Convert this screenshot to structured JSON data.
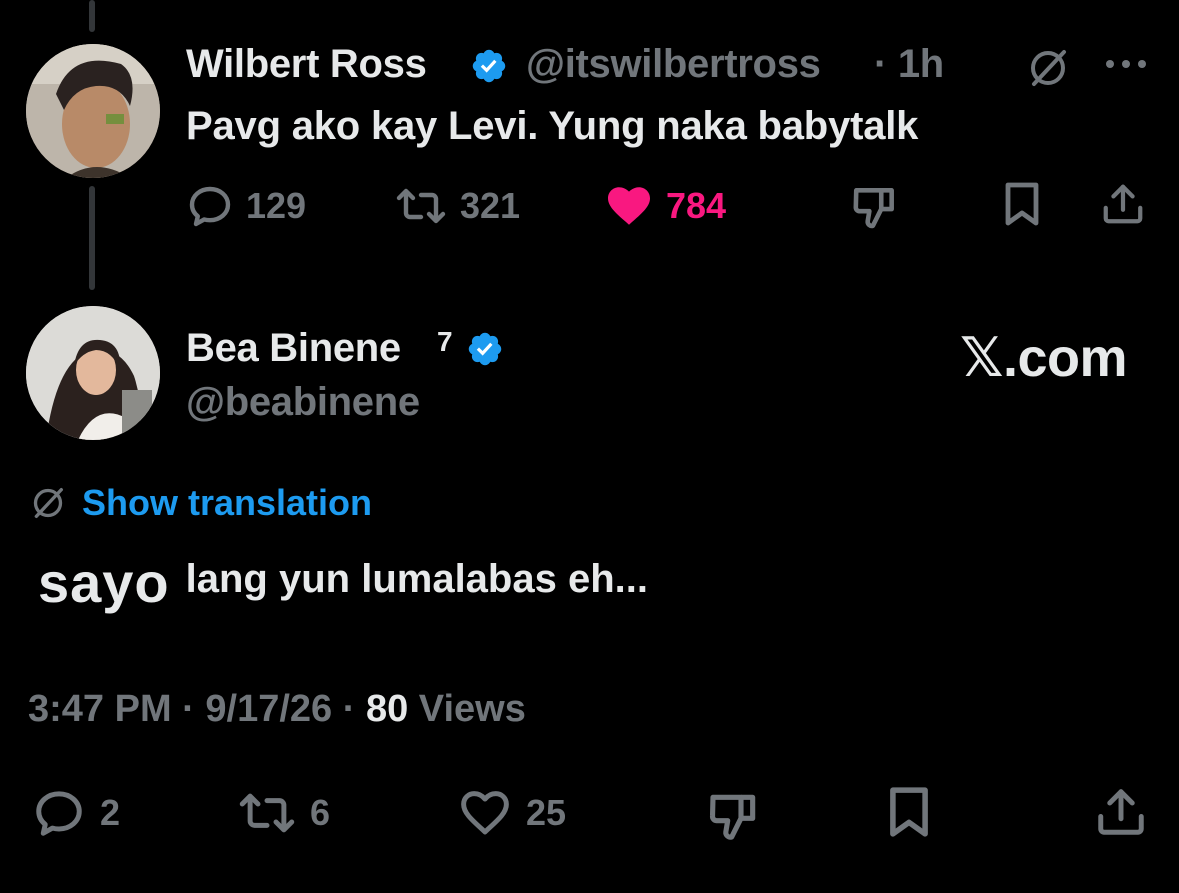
{
  "first_tweet": {
    "author_name": "Wilbert Ross",
    "handle": "@itswilbertross",
    "time": "· 1h",
    "text": "Pavg ako kay Levi. Yung naka babytalk",
    "replies": "129",
    "retweets": "321",
    "likes": "784"
  },
  "second_tweet": {
    "author_name": "Bea Binene",
    "superscript": "7",
    "handle": "@beabinene",
    "watermark": "𝕏.com",
    "translation_label": "Show translation",
    "text_big": "sayo",
    "text_rest": "lang yun lumalabas eh...",
    "timestamp": "3:47 PM · 9/17/26 ·",
    "views_count": "80",
    "views_label": "Views",
    "replies": "2",
    "retweets": "6",
    "likes": "25"
  },
  "colors": {
    "background": "#000000",
    "text": "#e7e9ea",
    "muted": "#71767b",
    "accent": "#1d9bf0",
    "like": "#f91880"
  },
  "icons": [
    "verified-badge-icon",
    "grok-icon",
    "more-icon",
    "reply-icon",
    "retweet-icon",
    "heart-icon",
    "dislike-icon",
    "bookmark-icon",
    "share-icon",
    "translate-icon"
  ]
}
